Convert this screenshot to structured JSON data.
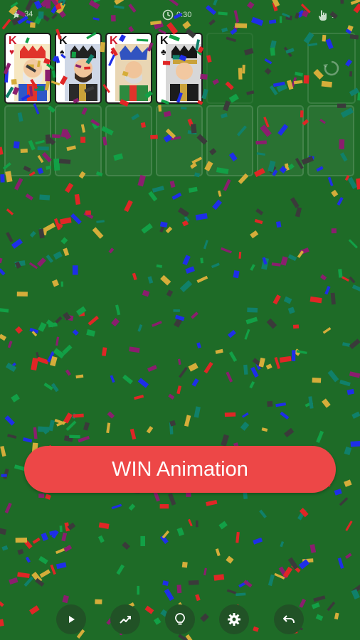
{
  "status": {
    "moves": "34",
    "time": "0:30",
    "score": "1"
  },
  "foundation": [
    {
      "rank": "K",
      "suit": "♥",
      "color": "red"
    },
    {
      "rank": "K",
      "suit": "♠",
      "color": "black"
    },
    {
      "rank": "K",
      "suit": "♦",
      "color": "red"
    },
    {
      "rank": "K",
      "suit": "♣",
      "color": "black"
    }
  ],
  "win_button": {
    "label": "WIN Animation"
  },
  "toolbar": [
    {
      "name": "play-button",
      "icon": "play-icon"
    },
    {
      "name": "stats-button",
      "icon": "trending-icon"
    },
    {
      "name": "hint-button",
      "icon": "lightbulb-icon"
    },
    {
      "name": "settings-button",
      "icon": "gear-icon"
    },
    {
      "name": "undo-button",
      "icon": "undo-icon"
    }
  ],
  "colors": {
    "table": "#1e6b27",
    "win_button": "#ed4747",
    "toolbar_button": "#215226",
    "confetti": [
      "#1e2ee8",
      "#e02626",
      "#d5ad3a",
      "#10806a",
      "#8a1e6e",
      "#3a3a3a",
      "#12a046"
    ]
  }
}
